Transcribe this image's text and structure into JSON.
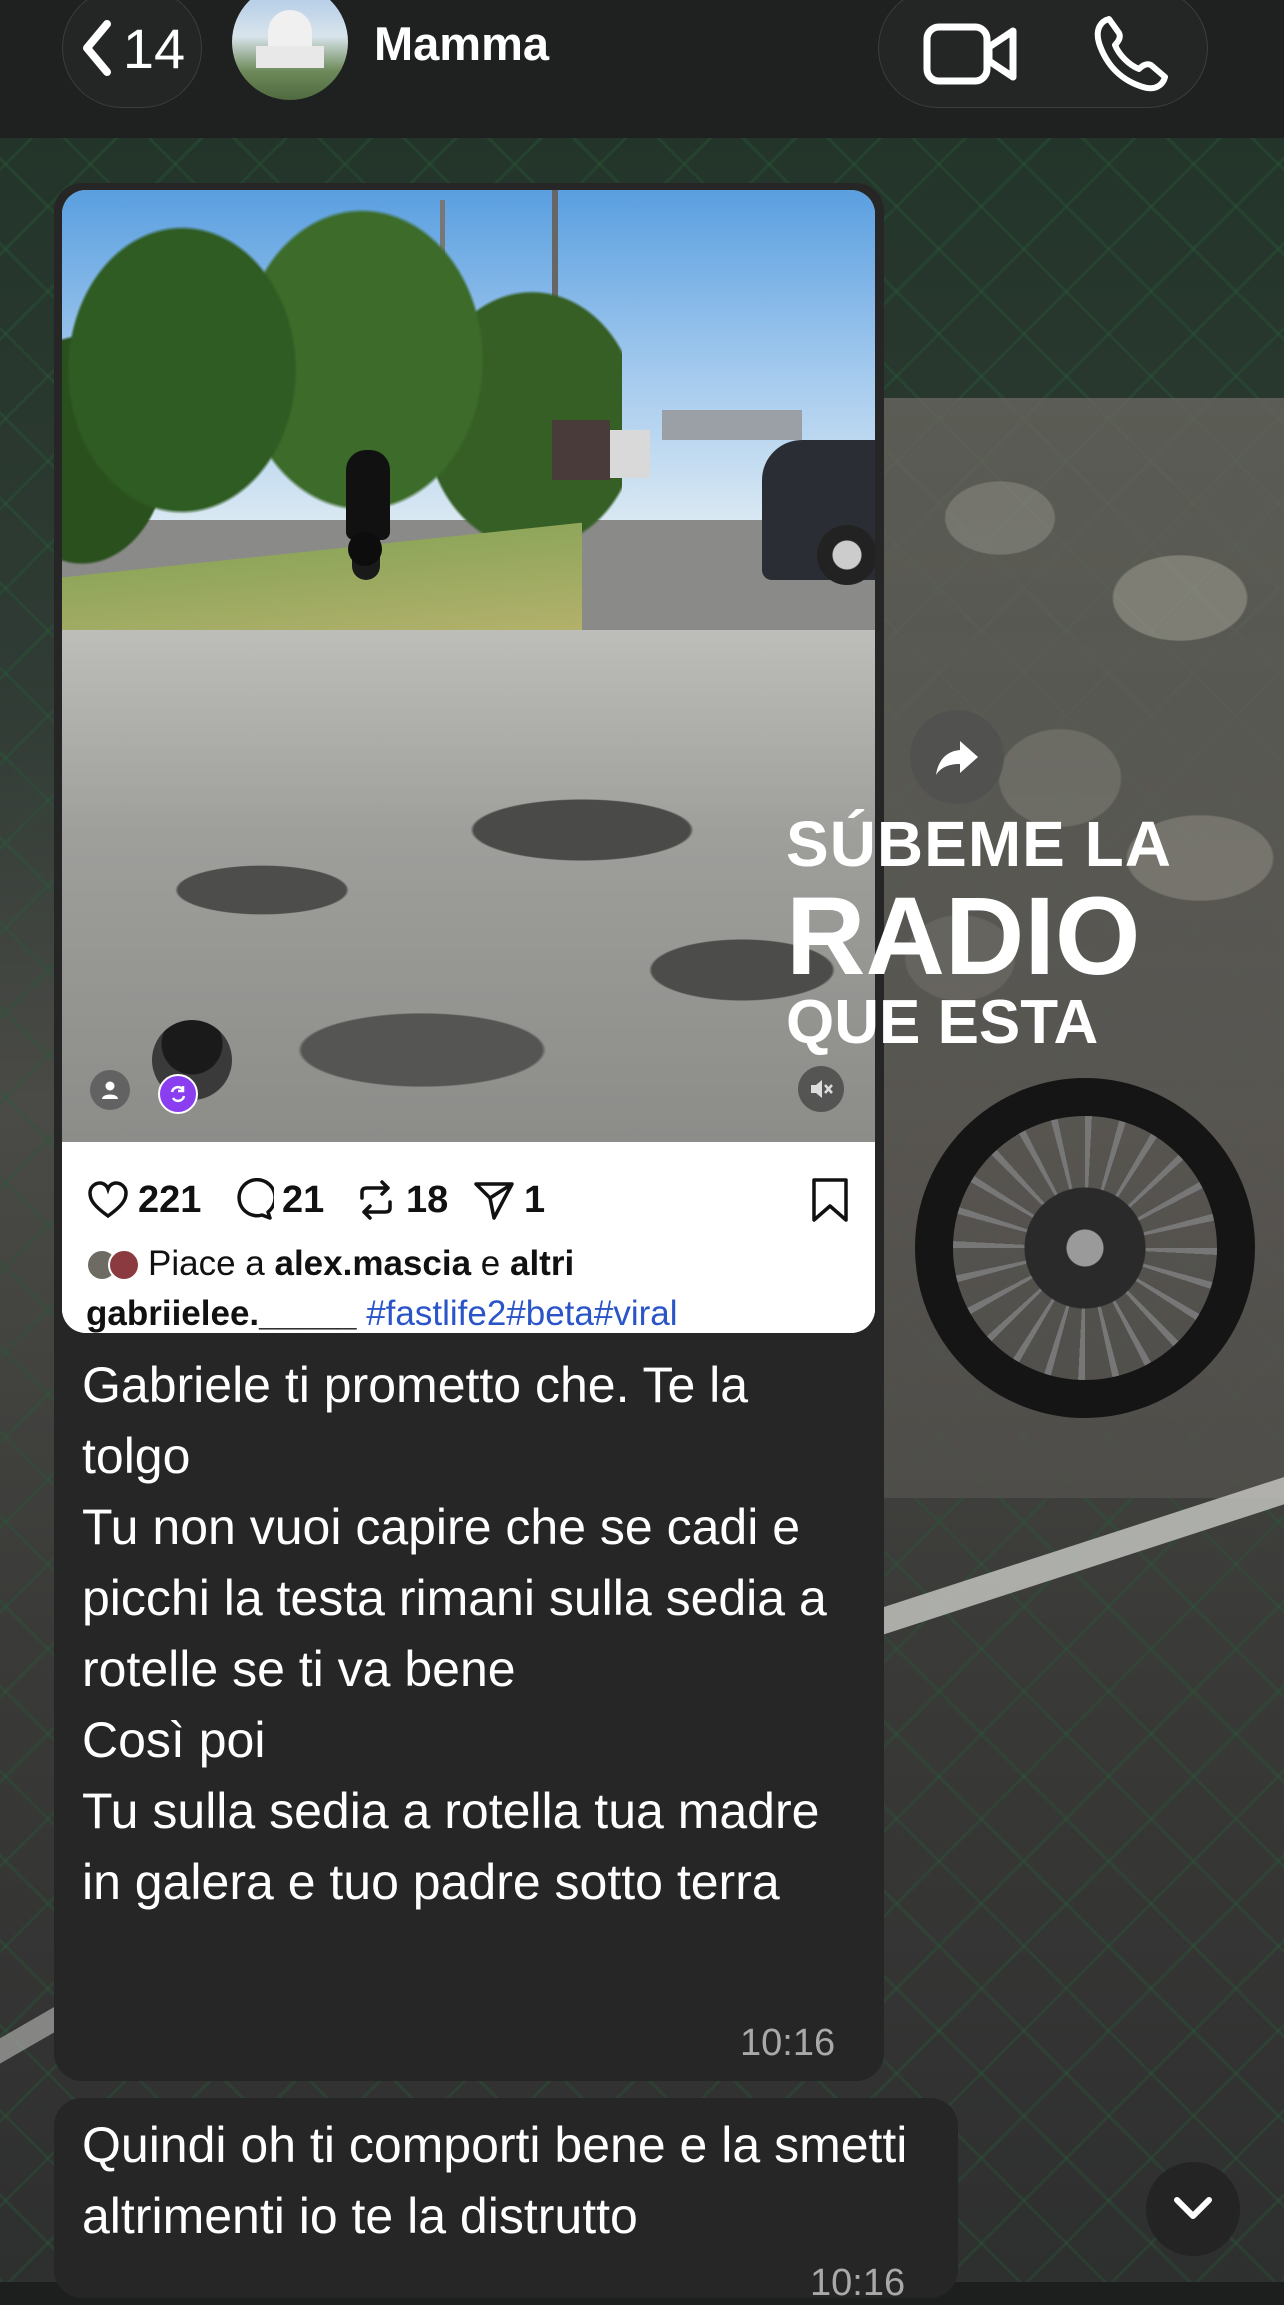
{
  "header": {
    "back_count": "14",
    "contact_name": "Mamma",
    "icons": [
      "chevron-left-icon",
      "video-call-icon",
      "phone-icon"
    ]
  },
  "shared_post": {
    "stats": {
      "likes": "221",
      "comments": "21",
      "reposts": "18",
      "shares": "1"
    },
    "liked_by_prefix": "Piace a ",
    "liked_by_user": "alex.mascia",
    "liked_by_mid": " e ",
    "liked_by_others": "altri",
    "caption_user": "gabriielee._____",
    "caption_tags": " #fastlife2#beta#viral"
  },
  "overlay": {
    "line1": "SÚBEME LA",
    "line2": "RADIO",
    "line3": "QUE ESTA"
  },
  "messages": [
    {
      "text": "Gabriele ti prometto che. Te la tolgo\nTu non vuoi capire che se cadi e picchi la testa rimani sulla sedia a rotelle se ti va bene\nCosì poi\nTu sulla sedia a rotella tua madre in galera e tuo padre sotto terra",
      "time": "10:16"
    },
    {
      "text": "Quindi oh ti comporti bene e la smetti altrimenti io te la distrutto",
      "time": "10:16"
    }
  ],
  "colors": {
    "bubble": "#262626",
    "header_bg": "#1e211f",
    "hashtag": "#2a55c8",
    "repost_badge": "#8a3ef0"
  }
}
